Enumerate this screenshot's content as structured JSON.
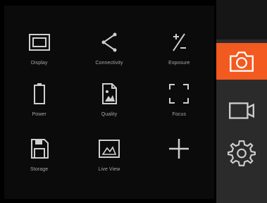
{
  "menu": {
    "items": [
      {
        "label": "Display",
        "icon": "display-icon"
      },
      {
        "label": "Connectivity",
        "icon": "share-icon"
      },
      {
        "label": "Exposure",
        "icon": "exposure-icon"
      },
      {
        "label": "Power",
        "icon": "battery-icon"
      },
      {
        "label": "Quality",
        "icon": "quality-icon"
      },
      {
        "label": "Focus",
        "icon": "focus-icon"
      },
      {
        "label": "Storage",
        "icon": "storage-icon"
      },
      {
        "label": "Live View",
        "icon": "live-view-icon"
      },
      {
        "label": "",
        "icon": "add-icon"
      }
    ]
  },
  "sidebar": {
    "modes": [
      {
        "name": "photo",
        "icon": "camera-icon",
        "active": true
      },
      {
        "name": "video",
        "icon": "video-camera-icon",
        "active": false
      },
      {
        "name": "settings",
        "icon": "gear-icon",
        "active": false
      }
    ]
  },
  "colors": {
    "accent": "#f25a1f",
    "sidebar": "#2b2b2b",
    "icon": "#cfcfcf",
    "label": "#a9a9a9"
  }
}
